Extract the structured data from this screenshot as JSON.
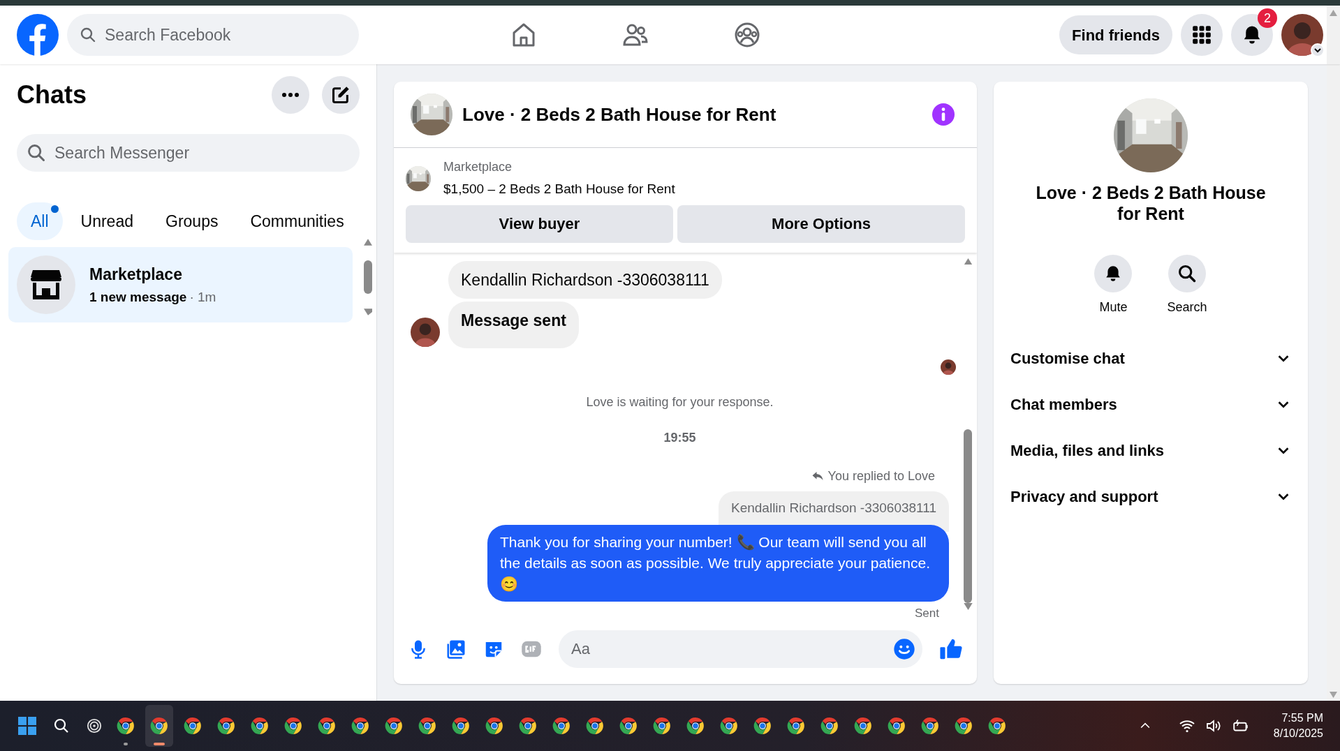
{
  "top_bar": {
    "search_placeholder": "Search Facebook",
    "find_friends": "Find friends",
    "notification_count": "2"
  },
  "sidebar": {
    "title": "Chats",
    "search_placeholder": "Search Messenger",
    "filters": [
      {
        "label": "All",
        "selected": true,
        "unread_dot": true
      },
      {
        "label": "Unread",
        "selected": false,
        "unread_dot": false
      },
      {
        "label": "Groups",
        "selected": false,
        "unread_dot": false
      },
      {
        "label": "Communities",
        "selected": false,
        "unread_dot": false
      }
    ],
    "chats": [
      {
        "name": "Marketplace",
        "preview": "1 new message",
        "time": "· 1m",
        "selected": true
      }
    ]
  },
  "conversation": {
    "title": "Love · 2 Beds 2 Bath House for Rent",
    "listing": {
      "source": "Marketplace",
      "title": "$1,500 – 2 Beds 2 Bath House for Rent"
    },
    "actions": [
      "View buyer",
      "More Options"
    ],
    "messages": [
      {
        "kind": "incoming",
        "text": "Kendallin Richardson -3306038111",
        "emphasis": false,
        "avatar": false
      },
      {
        "kind": "incoming",
        "text": "Message sent",
        "emphasis": true,
        "avatar": true
      },
      {
        "kind": "read_receipt"
      },
      {
        "kind": "notice",
        "text": "Love is waiting for your response."
      },
      {
        "kind": "timestamp",
        "text": "19:55"
      },
      {
        "kind": "reply",
        "label": "You replied to Love",
        "quote": "Kendallin Richardson -3306038111",
        "text": "Thank you for sharing your number! 📞 Our team will send you all the details as soon as possible. We truly appreciate your patience. 😊",
        "status": "Sent"
      }
    ],
    "composer": {
      "placeholder": "Aa"
    }
  },
  "details": {
    "title": "Love · 2 Beds 2 Bath House for Rent",
    "actions": [
      {
        "kind": "mute",
        "label": "Mute"
      },
      {
        "kind": "search",
        "label": "Search"
      }
    ],
    "sections": [
      {
        "label": "Customise chat",
        "expanded": false
      },
      {
        "label": "Chat members",
        "expanded": false
      },
      {
        "label": "Media, files and links",
        "expanded": false
      },
      {
        "label": "Privacy and support",
        "expanded": false
      }
    ]
  },
  "taskbar": {
    "apps": [
      {
        "selected": false,
        "running": true
      },
      {
        "selected": true,
        "running": true
      },
      {
        "selected": false,
        "running": false
      },
      {
        "selected": false,
        "running": false
      },
      {
        "selected": false,
        "running": false
      },
      {
        "selected": false,
        "running": false
      },
      {
        "selected": false,
        "running": false
      },
      {
        "selected": false,
        "running": false
      },
      {
        "selected": false,
        "running": false
      },
      {
        "selected": false,
        "running": false
      },
      {
        "selected": false,
        "running": false
      },
      {
        "selected": false,
        "running": false
      },
      {
        "selected": false,
        "running": false
      },
      {
        "selected": false,
        "running": false
      },
      {
        "selected": false,
        "running": false
      },
      {
        "selected": false,
        "running": false
      },
      {
        "selected": false,
        "running": false
      },
      {
        "selected": false,
        "running": false
      },
      {
        "selected": false,
        "running": false
      },
      {
        "selected": false,
        "running": false
      },
      {
        "selected": false,
        "running": false
      },
      {
        "selected": false,
        "running": false
      },
      {
        "selected": false,
        "running": false
      },
      {
        "selected": false,
        "running": false
      },
      {
        "selected": false,
        "running": false
      },
      {
        "selected": false,
        "running": false
      },
      {
        "selected": false,
        "running": false
      }
    ],
    "time": "7:55 PM",
    "date": "8/10/2025"
  }
}
